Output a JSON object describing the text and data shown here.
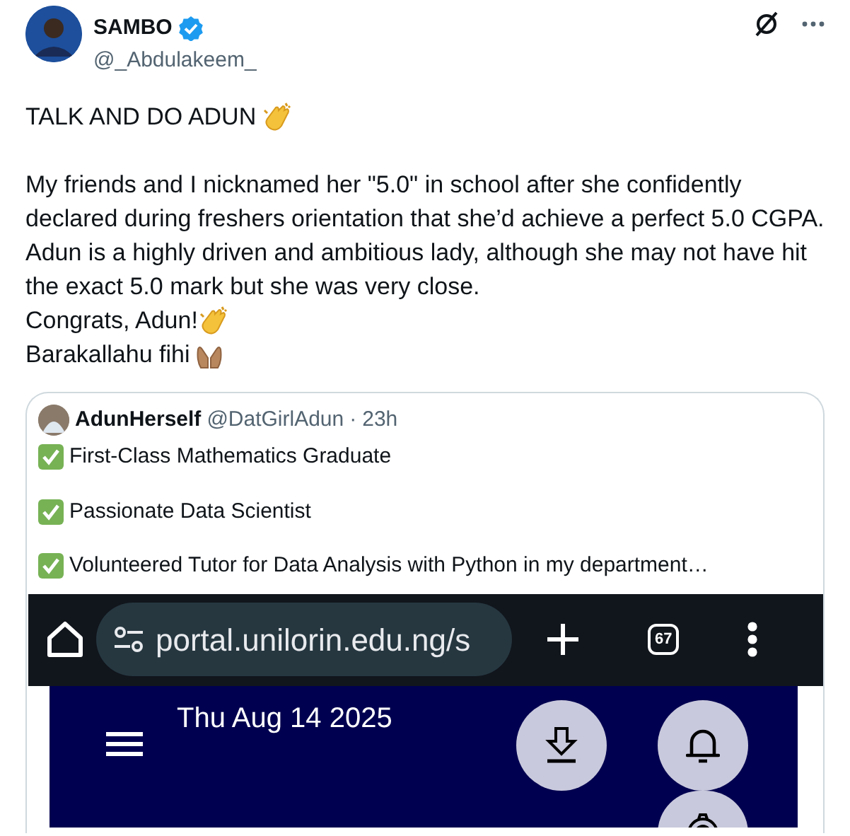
{
  "post": {
    "author": "SAMBO",
    "verified": true,
    "handle": "@_Abdulakeem_",
    "title": "TALK AND DO ADUN",
    "body": "My friends and I nicknamed her \"5.0\" in school after she confidently declared during freshers orientation that she’d achieve a perfect 5.0 CGPA. Adun is a highly driven and ambitious lady, although she may not have hit the exact 5.0 mark but she was very close.",
    "congrats": "Congrats, Adun!",
    "closing": "Barakallahu fihi"
  },
  "quote": {
    "author": "AdunHerself",
    "handle": "@DatGirlAdun",
    "separator": "·",
    "time": "23h",
    "items": [
      {
        "text": "First-Class Mathematics Graduate"
      },
      {
        "text": "Passionate Data Scientist"
      },
      {
        "text": "Volunteered Tutor for Data Analysis with Python in my department…"
      }
    ],
    "screenshot": {
      "url": "portal.unilorin.edu.ng/s",
      "tab_count": "67",
      "date": "Thu Aug 14 2025"
    }
  }
}
